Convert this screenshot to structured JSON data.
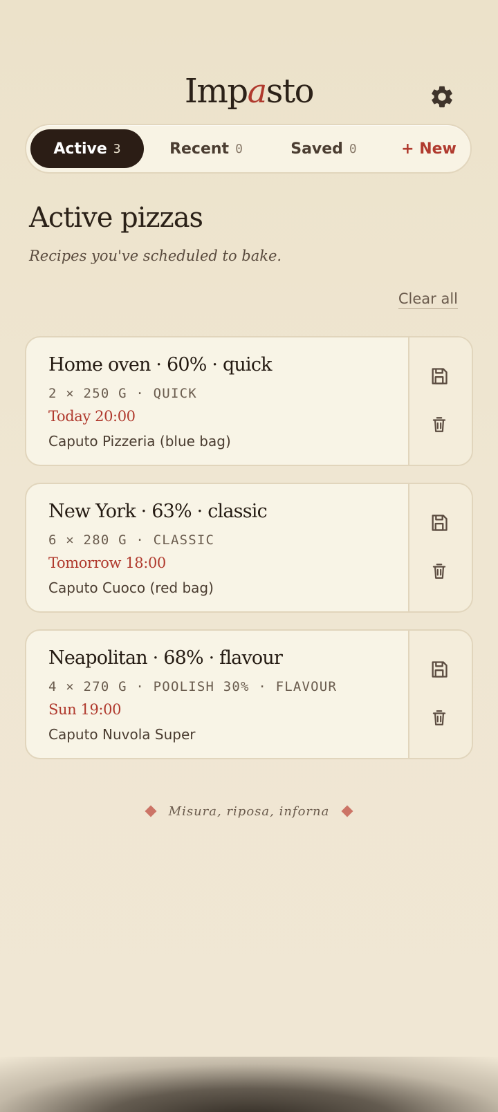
{
  "app": {
    "title_start": "Imp",
    "title_accent": "a",
    "title_end": "sto"
  },
  "header": {
    "settings_icon": "gear-icon"
  },
  "tabs": [
    {
      "label": "Active",
      "count": "3",
      "selected": true
    },
    {
      "label": "Recent",
      "count": "0",
      "selected": false
    },
    {
      "label": "Saved",
      "count": "0",
      "selected": false
    }
  ],
  "new_button": {
    "label": "+ New"
  },
  "section": {
    "title": "Active pizzas",
    "subtitle": "Recipes you've scheduled to bake.",
    "clear_all_label": "Clear all"
  },
  "pizzas": [
    {
      "title": "Home oven · 60% · quick",
      "specs": "2 × 250 G · QUICK",
      "scheduled": "Today 20:00",
      "flour": "Caputo Pizzeria (blue bag)"
    },
    {
      "title": "New York · 63% · classic",
      "specs": "6 × 280 G · CLASSIC",
      "scheduled": "Tomorrow 18:00",
      "flour": "Caputo Cuoco (red bag)"
    },
    {
      "title": "Neapolitan · 68% · flavour",
      "specs": "4 × 270 G · POOLISH 30% · FLAVOUR",
      "scheduled": "Sun 19:00",
      "flour": "Caputo Nuvola Super"
    }
  ],
  "card_actions": {
    "save_icon": "floppy-disk-icon",
    "delete_icon": "trash-icon"
  },
  "footer": {
    "motto": "Misura, riposa, inforna"
  },
  "colors": {
    "accent": "#b03a2e",
    "ink": "#2b2118",
    "background": "#ede4cf",
    "card": "#f8f4e6",
    "tab_active_bg": "#2b1d15"
  }
}
